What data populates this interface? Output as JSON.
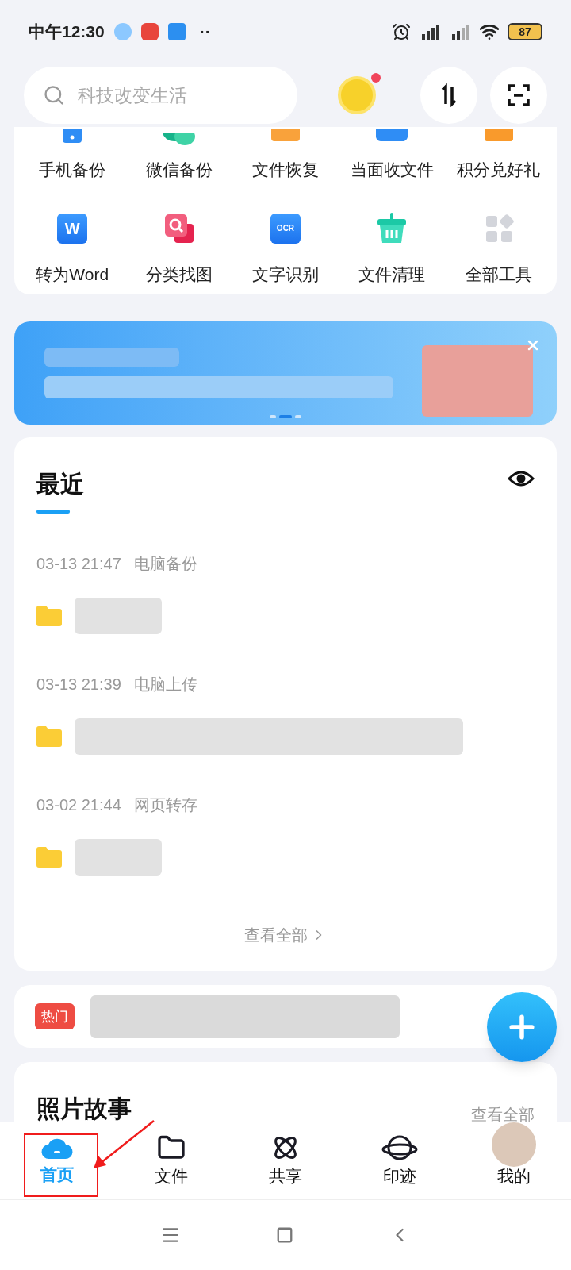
{
  "status_bar": {
    "time": "中午12:30",
    "more": "··",
    "battery": "87"
  },
  "search": {
    "placeholder": "科技改变生活"
  },
  "tools": {
    "rows": [
      [
        {
          "label": "手机备份",
          "kind": "phone"
        },
        {
          "label": "微信备份",
          "kind": "chat"
        },
        {
          "label": "文件恢复",
          "kind": "restore"
        },
        {
          "label": "当面收文件",
          "kind": "receive"
        },
        {
          "label": "积分兑好礼",
          "kind": "gift"
        }
      ],
      [
        {
          "label": "转为Word",
          "kind": "word",
          "icon_text": "W"
        },
        {
          "label": "分类找图",
          "kind": "find"
        },
        {
          "label": "文字识别",
          "kind": "ocr",
          "icon_text": "OCR"
        },
        {
          "label": "文件清理",
          "kind": "clean"
        },
        {
          "label": "全部工具",
          "kind": "all"
        }
      ]
    ]
  },
  "banner": {
    "pages": [
      {
        "selected": false
      },
      {
        "selected": true
      },
      {
        "selected": false
      }
    ]
  },
  "recent": {
    "title": "最近",
    "groups": [
      {
        "time": "03-13 21:47",
        "source": "电脑备份"
      },
      {
        "time": "03-13 21:39",
        "source": "电脑上传"
      },
      {
        "time": "03-02 21:44",
        "source": "网页转存"
      }
    ],
    "view_all": "查看全部"
  },
  "hot": {
    "badge": "热门"
  },
  "photo_story": {
    "title": "照片故事",
    "view_all": "查看全部"
  },
  "nav": [
    {
      "label": "首页",
      "kind": "home",
      "selected": true
    },
    {
      "label": "文件",
      "kind": "files",
      "selected": false
    },
    {
      "label": "共享",
      "kind": "share",
      "selected": false
    },
    {
      "label": "印迹",
      "kind": "planet",
      "selected": false
    },
    {
      "label": "我的",
      "kind": "avatar",
      "selected": false
    }
  ]
}
